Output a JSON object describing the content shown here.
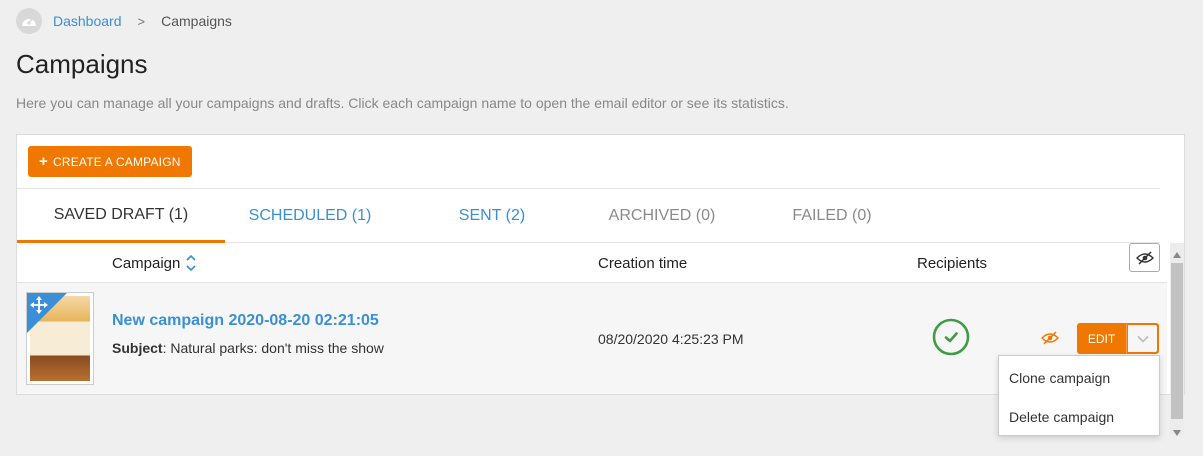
{
  "breadcrumb": {
    "home_icon": "dashboard-gauge-icon",
    "dashboard_label": "Dashboard",
    "separator": ">",
    "current_label": "Campaigns"
  },
  "page": {
    "title": "Campaigns",
    "description": "Here you can manage all your campaigns and drafts. Click each campaign name to open the email editor or see its statistics."
  },
  "toolbar": {
    "create_icon": "+",
    "create_label": "CREATE A CAMPAIGN"
  },
  "tabs": [
    {
      "label": "SAVED DRAFT (1)",
      "state": "active"
    },
    {
      "label": "SCHEDULED (1)",
      "state": "link"
    },
    {
      "label": "SENT (2)",
      "state": "link"
    },
    {
      "label": "ARCHIVED (0)",
      "state": "muted"
    },
    {
      "label": "FAILED (0)",
      "state": "muted"
    }
  ],
  "table": {
    "columns": {
      "campaign": "Campaign",
      "creation_time": "Creation time",
      "recipients": "Recipients"
    },
    "rows": [
      {
        "name": "New campaign 2020-08-20 02:21:05",
        "subject_label": "Subject",
        "subject_value": ": Natural parks: don't miss the show",
        "creation_time": "08/20/2020 4:25:23 PM",
        "recipients_status": "check-circle-icon",
        "edit_label": "EDIT"
      }
    ]
  },
  "dropdown": {
    "items": [
      "Clone campaign",
      "Delete campaign"
    ]
  },
  "colors": {
    "accent": "#f07800",
    "link": "#3a8fd6",
    "success": "#3f9b45",
    "background": "#efefef"
  }
}
